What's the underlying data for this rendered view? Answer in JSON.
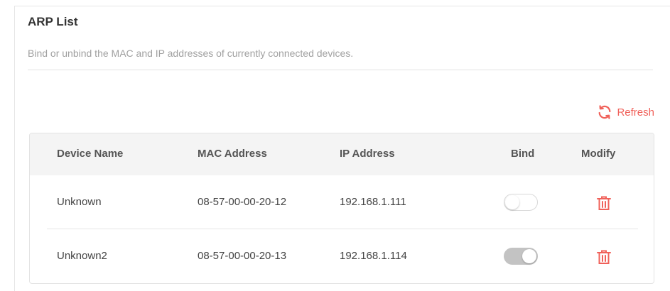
{
  "section": {
    "title": "ARP List",
    "description": "Bind or unbind the MAC and IP addresses of currently connected devices."
  },
  "toolbar": {
    "refresh_label": "Refresh",
    "refresh_icon": "refresh-icon"
  },
  "table": {
    "headers": {
      "device_name": "Device Name",
      "mac_address": "MAC Address",
      "ip_address": "IP Address",
      "bind": "Bind",
      "modify": "Modify"
    },
    "rows": [
      {
        "device_name": "Unknown",
        "mac_address": "08-57-00-00-20-12",
        "ip_address": "192.168.1.111",
        "bind": false,
        "modify_icon": "trash-icon"
      },
      {
        "device_name": "Unknown2",
        "mac_address": "08-57-00-00-20-13",
        "ip_address": "192.168.1.114",
        "bind": true,
        "modify_icon": "trash-icon"
      }
    ]
  },
  "colors": {
    "accent": "#f0615a",
    "header_bg": "#f4f4f4",
    "toggle_on": "#c3c3c3",
    "toggle_off_border": "#d9d9d9"
  }
}
